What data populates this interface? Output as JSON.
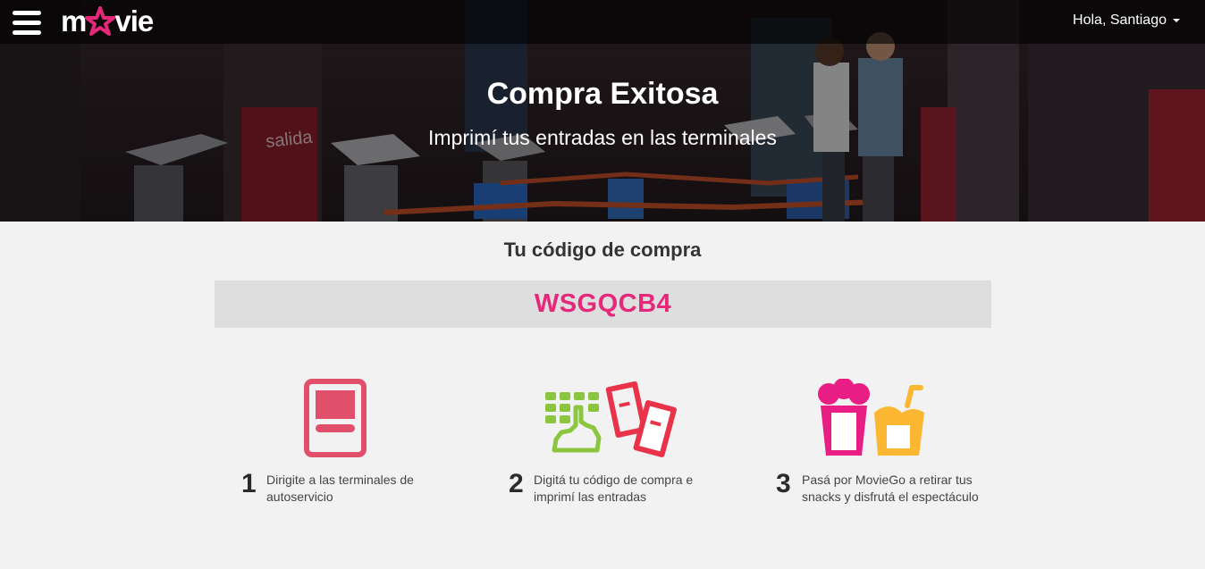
{
  "header": {
    "logo_text_left": "m",
    "logo_text_right": "vie",
    "user_greeting": "Hola, Santiago"
  },
  "hero": {
    "title": "Compra Exitosa",
    "subtitle": "Imprimí tus entradas en las terminales",
    "background_sign": "salida"
  },
  "purchase": {
    "heading": "Tu código de compra",
    "code": "WSGQCB4"
  },
  "steps": [
    {
      "number": "1",
      "text": "Dirigite a las terminales de autoservicio",
      "icon": "terminal-icon"
    },
    {
      "number": "2",
      "text": "Digitá tu código de compra e imprimí las entradas",
      "icon": "keypad-tickets-icon"
    },
    {
      "number": "3",
      "text": "Pasá por MovieGo a retirar tus snacks y disfrutá el espectáculo",
      "icon": "popcorn-drink-icon"
    }
  ],
  "colors": {
    "brand_pink": "#e5287a",
    "terminal_red": "#e0506a",
    "keypad_green": "#8cc63f",
    "ticket_red": "#e8334a",
    "drink_yellow": "#fbb731"
  }
}
